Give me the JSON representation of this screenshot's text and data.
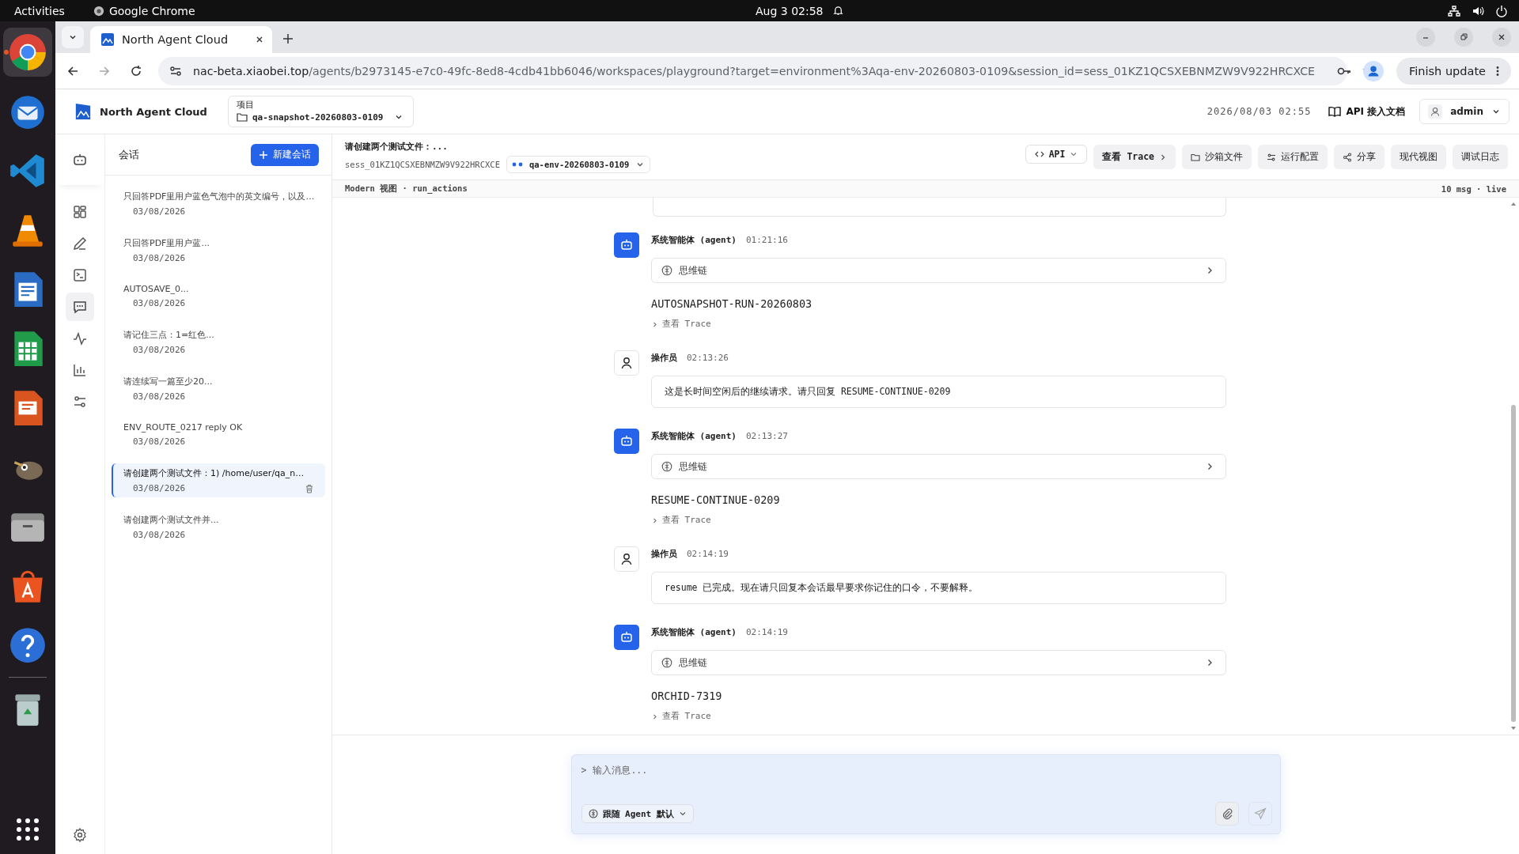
{
  "system_bar": {
    "activities": "Activities",
    "app": "Google Chrome",
    "clock": "Aug 3  02:58"
  },
  "dock": [
    {
      "kind": "browser",
      "selected": true,
      "running": true
    },
    {
      "kind": "mail",
      "selected": false,
      "running": false
    },
    {
      "kind": "code",
      "selected": false,
      "running": false
    },
    {
      "kind": "cone",
      "selected": false,
      "running": false
    },
    {
      "kind": "writer",
      "selected": false,
      "running": false
    },
    {
      "kind": "calc",
      "selected": false,
      "running": false
    },
    {
      "kind": "impress",
      "selected": false,
      "running": false
    },
    {
      "kind": "gimp",
      "selected": false,
      "running": false
    },
    {
      "kind": "files",
      "selected": false,
      "running": false
    },
    {
      "kind": "store",
      "selected": false,
      "running": false
    },
    {
      "kind": "help",
      "selected": false,
      "running": false
    },
    {
      "kind": "trash",
      "selected": false,
      "running": false
    }
  ],
  "browser": {
    "tab_title": "North Agent Cloud",
    "url_host": "nac-beta.xiaobei.top",
    "url_path": "/agents/b2973145-e7c0-49fc-8ed8-4cdb41bb6046/workspaces/playground?target=environment%3Aqa-env-20260803-0109&session_id=sess_01KZ1QCSXEBNMZW9V922HRCXCE",
    "update_button": "Finish update"
  },
  "header": {
    "brand": "North Agent Cloud",
    "project_label": "项目",
    "project": "qa-snapshot-20260803-0109",
    "datetime": "2026/08/03 02:55",
    "docs_link": "API 接入文档",
    "user": "admin"
  },
  "rail": [
    {
      "kind": "grid",
      "selected": false
    },
    {
      "kind": "pencil",
      "selected": false
    },
    {
      "kind": "terminal",
      "selected": false
    },
    {
      "kind": "chat",
      "selected": true
    },
    {
      "kind": "activity",
      "selected": false
    },
    {
      "kind": "chart",
      "selected": false
    },
    {
      "kind": "sliders",
      "selected": false
    }
  ],
  "sessions": {
    "title": "会话",
    "new_button": "新建会话",
    "items": [
      {
        "title": "只回答PDF里用户蓝色气泡中的英文编号，以及…",
        "date": "03/08/2026",
        "selected": false
      },
      {
        "title": "只回答PDF里用户蓝...",
        "date": "03/08/2026",
        "selected": false
      },
      {
        "title": "AUTOSAVE_0...",
        "date": "03/08/2026",
        "selected": false
      },
      {
        "title": "请记住三点：1=红色...",
        "date": "03/08/2026",
        "selected": false
      },
      {
        "title": "请连续写一篇至少20...",
        "date": "03/08/2026",
        "selected": false
      },
      {
        "title": "ENV_ROUTE_0217 reply OK",
        "date": "03/08/2026",
        "selected": false
      },
      {
        "title": "请创建两个测试文件：1) /home/user/qa_n…",
        "date": "03/08/2026",
        "selected": true
      },
      {
        "title": "请创建两个测试文件并...",
        "date": "03/08/2026",
        "selected": false
      }
    ]
  },
  "conversation": {
    "title": "请创建两个测试文件：...",
    "session_id": "sess_01KZ1QCSXEBNMZW9V922HRCXCE",
    "environment": "qa-env-20260803-0109",
    "toolbar": [
      {
        "kind": "api",
        "label": "API"
      },
      {
        "kind": "trace",
        "label": "查看 Trace"
      },
      {
        "kind": "folder",
        "label": "沙箱文件"
      },
      {
        "kind": "config",
        "label": "运行配置"
      },
      {
        "kind": "share",
        "label": "分享"
      },
      {
        "kind": "plain",
        "label": "现代视图"
      },
      {
        "kind": "plain",
        "label": "调试日志"
      }
    ],
    "view_info": "Modern 视图 · run_actions",
    "stats": "10 msg · live"
  },
  "messages": [
    {
      "kind": "agent",
      "author": "系统智能体 (agent)",
      "time": "01:21:16",
      "thinking": "思维链",
      "text": "AUTOSNAPSHOT-RUN-20260803",
      "trace": "查看 Trace"
    },
    {
      "kind": "user",
      "author": "操作员",
      "time": "02:13:26",
      "text": "这是长时间空闲后的继续请求。请只回复 RESUME-CONTINUE-0209"
    },
    {
      "kind": "agent",
      "author": "系统智能体 (agent)",
      "time": "02:13:27",
      "thinking": "思维链",
      "text": "RESUME-CONTINUE-0209",
      "trace": "查看 Trace"
    },
    {
      "kind": "user",
      "author": "操作员",
      "time": "02:14:19",
      "text": "resume 已完成。现在请只回复本会话最早要求你记住的口令，不要解释。"
    },
    {
      "kind": "agent",
      "author": "系统智能体 (agent)",
      "time": "02:14:19",
      "thinking": "思维链",
      "text": "ORCHID-7319",
      "trace": "查看 Trace"
    }
  ],
  "composer": {
    "prompt": ">",
    "placeholder": "输入消息...",
    "mode": "跟随 Agent 默认"
  }
}
